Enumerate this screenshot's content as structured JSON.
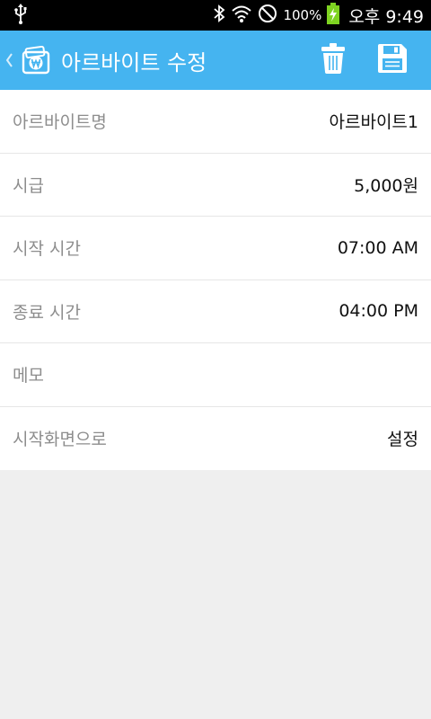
{
  "status_bar": {
    "battery_percent": "100%",
    "time": "오후 9:49",
    "icons": [
      "usb-icon",
      "bluetooth-icon",
      "wifi-icon",
      "no-signal-icon",
      "battery-charging-icon"
    ]
  },
  "action_bar": {
    "title": "아르바이트 수정",
    "background_color": "#45b4f0",
    "app_icon": "wallet-won-icon",
    "actions": [
      "trash-icon",
      "save-icon"
    ]
  },
  "form": {
    "rows": [
      {
        "label": "아르바이트명",
        "value": "아르바이트1"
      },
      {
        "label": "시급",
        "value": "5,000원"
      },
      {
        "label": "시작 시간",
        "value": "07:00 AM"
      },
      {
        "label": "종료 시간",
        "value": "04:00 PM"
      },
      {
        "label": "메모",
        "value": ""
      },
      {
        "label": "시작화면으로",
        "value": "설정"
      }
    ]
  }
}
